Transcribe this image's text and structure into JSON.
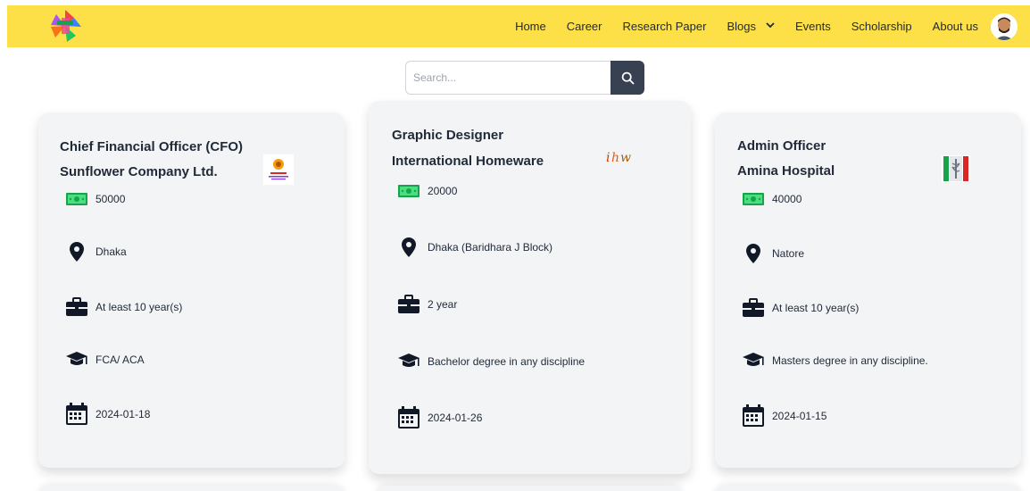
{
  "nav": {
    "links": [
      "Home",
      "Career",
      "Research Paper",
      "Blogs",
      "Events",
      "Scholarship",
      "About us"
    ]
  },
  "search": {
    "placeholder": "Search..."
  },
  "jobs": [
    {
      "title": "Chief Financial Officer (CFO)",
      "company": "Sunflower Company Ltd.",
      "salary": "50000",
      "location": "Dhaka",
      "experience": "At least 10 year(s)",
      "education": "FCA/ ACA",
      "deadline": "2024-01-18"
    },
    {
      "title": "Graphic Designer",
      "company": "International Homeware",
      "salary": "20000",
      "location": "Dhaka (Baridhara J Block)",
      "experience": "2 year",
      "education": "Bachelor degree in any discipline",
      "deadline": "2024-01-26"
    },
    {
      "title": "Admin Officer",
      "company": "Amina Hospital",
      "salary": "40000",
      "location": "Natore",
      "experience": "At least 10 year(s)",
      "education": "Masters degree in any discipline.",
      "deadline": "2024-01-15"
    }
  ],
  "colors": {
    "navbar": "#fde047",
    "search_button": "#374151",
    "card_bg": "#f3f4f6",
    "money_green": "#22c55e"
  },
  "icons": {
    "salary": "money-icon",
    "location": "map-pin-icon",
    "experience": "briefcase-icon",
    "education": "graduation-cap-icon",
    "deadline": "calendar-icon",
    "search": "search-icon",
    "blogs_dropdown": "chevron-down-icon"
  }
}
